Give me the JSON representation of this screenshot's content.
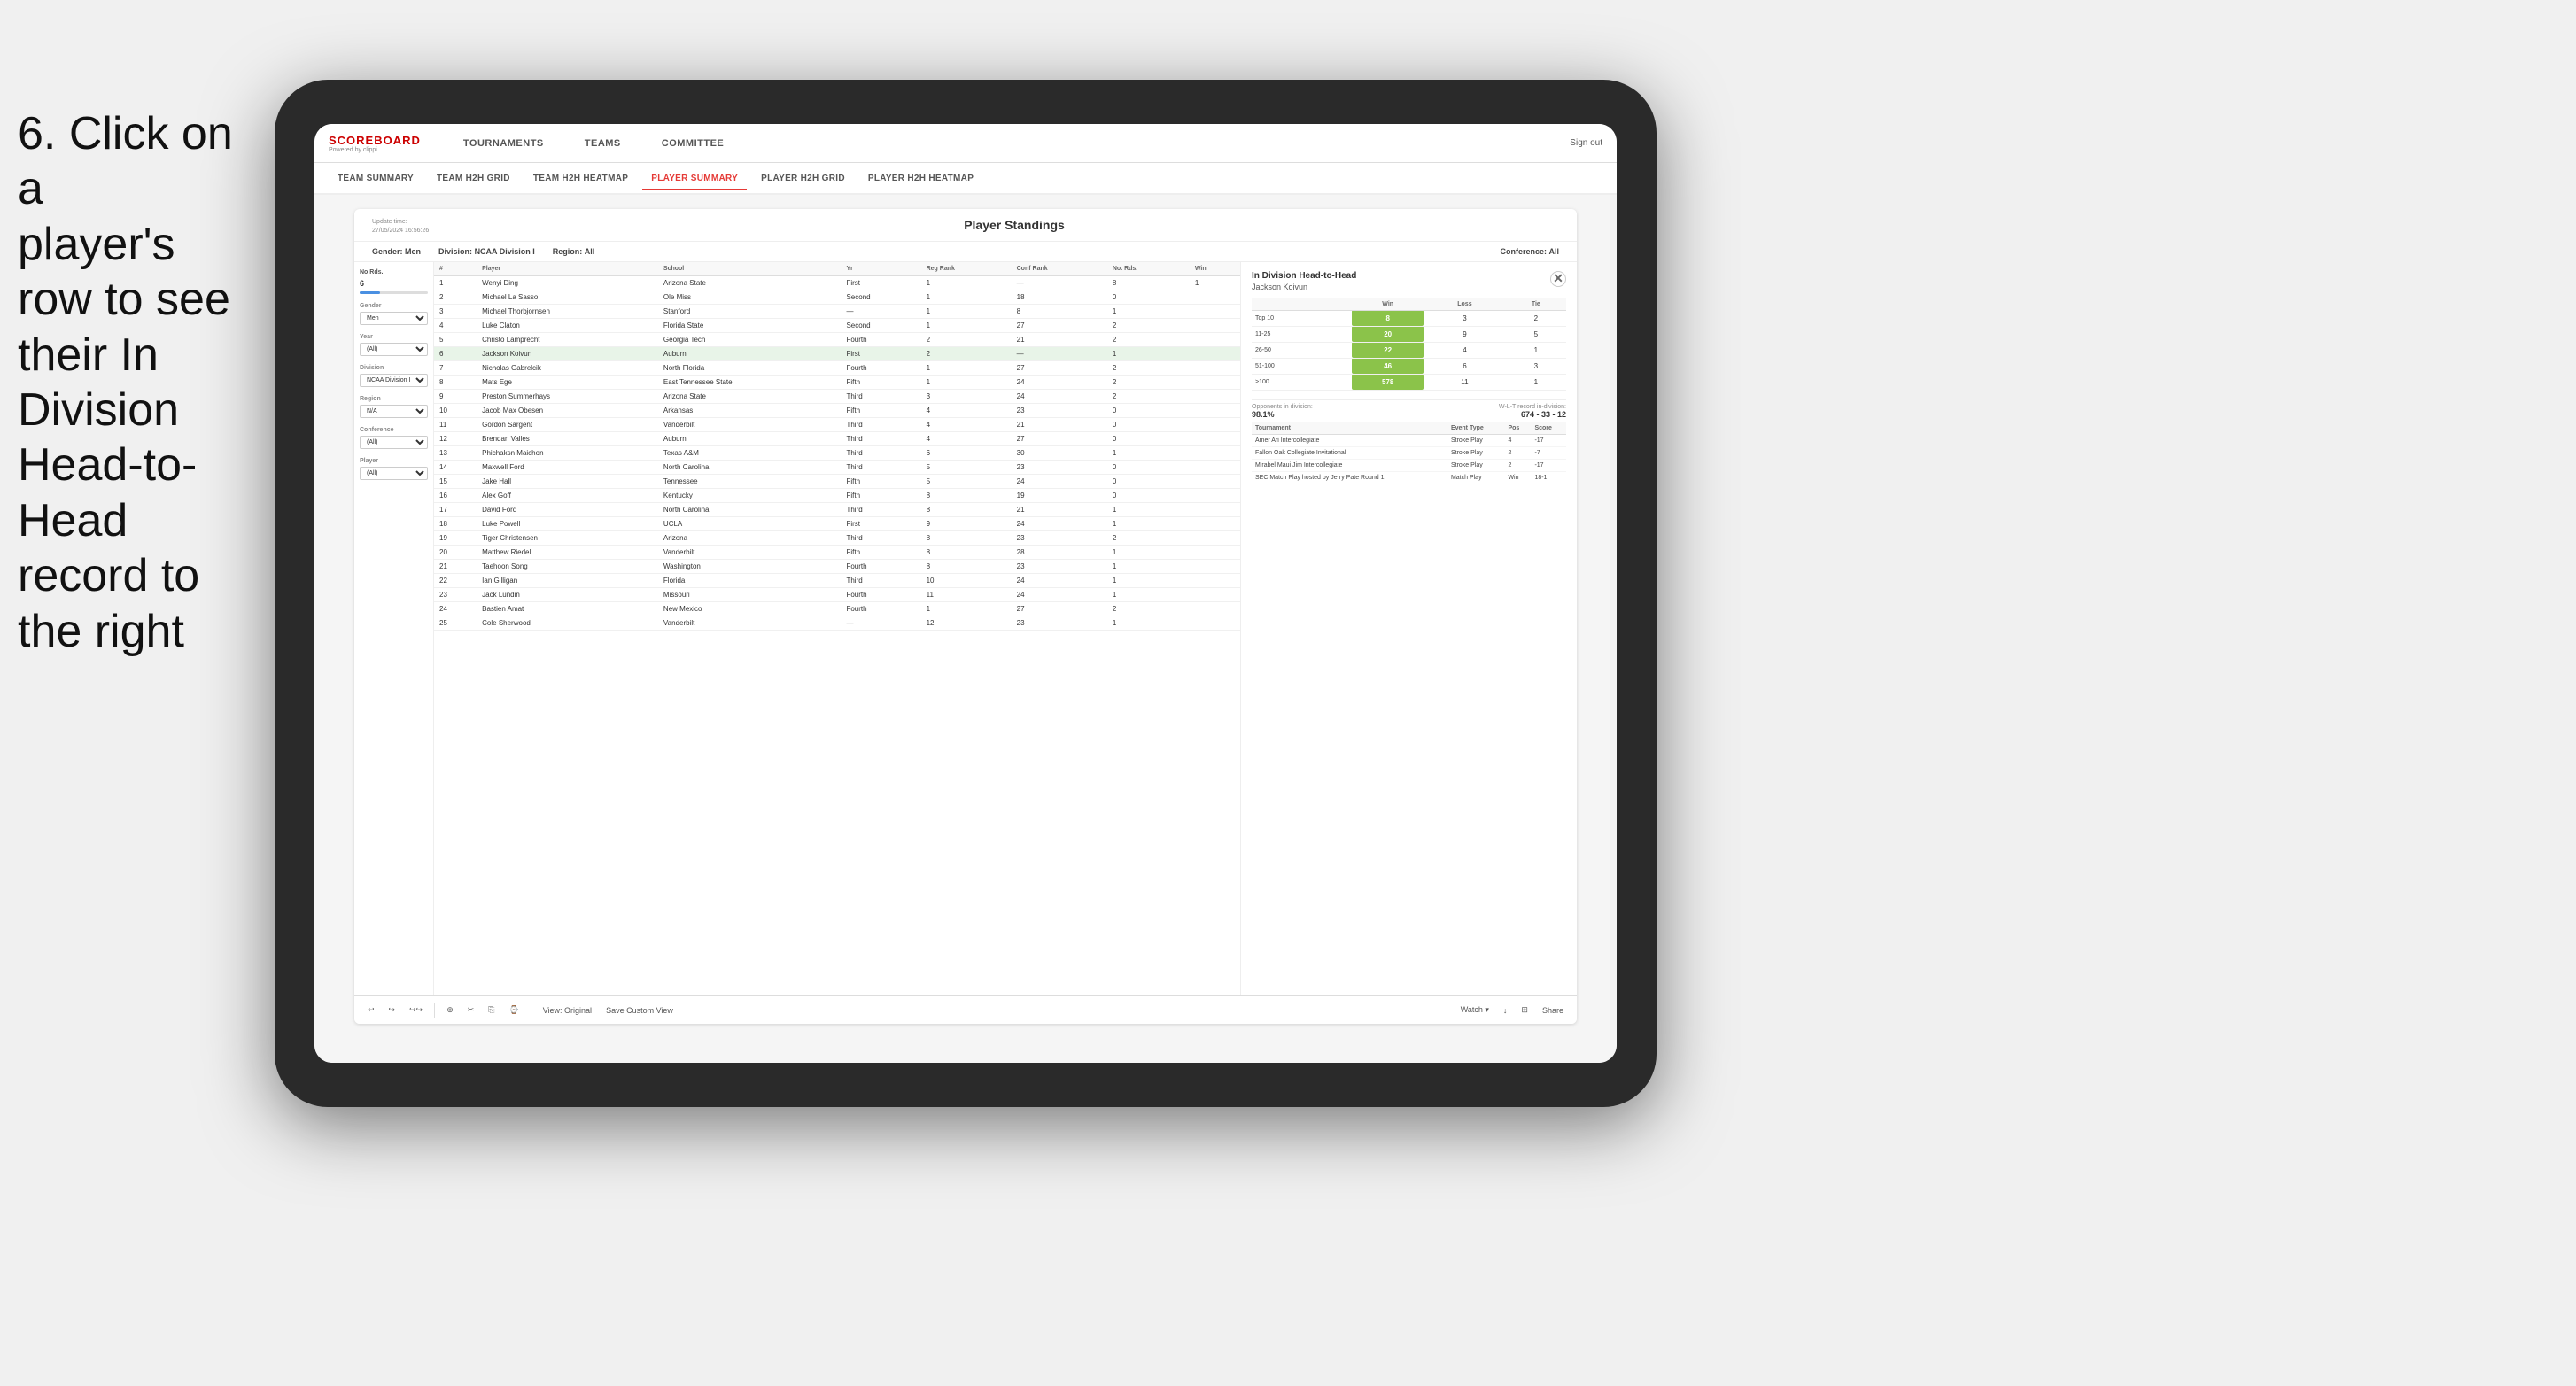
{
  "instruction": {
    "line1": "6. Click on a",
    "line2": "player's row to see",
    "line3": "their In Division",
    "line4": "Head-to-Head",
    "line5": "record to the right"
  },
  "nav": {
    "logo": "SCOREBOARD",
    "powered": "Powered by clippi",
    "items": [
      "TOURNAMENTS",
      "TEAMS",
      "COMMITTEE"
    ],
    "sign_out": "Sign out"
  },
  "sub_nav": {
    "items": [
      "TEAM SUMMARY",
      "TEAM H2H GRID",
      "TEAM H2H HEATMAP",
      "PLAYER SUMMARY",
      "PLAYER H2H GRID",
      "PLAYER H2H HEATMAP"
    ],
    "active": "PLAYER SUMMARY"
  },
  "card": {
    "update_time_label": "Update time:",
    "update_time_value": "27/05/2024 16:56:26",
    "title": "Player Standings",
    "filters": {
      "gender_label": "Gender:",
      "gender_value": "Men",
      "division_label": "Division:",
      "division_value": "NCAA Division I",
      "region_label": "Region:",
      "region_value": "All",
      "conference_label": "Conference:",
      "conference_value": "All"
    }
  },
  "sidebar": {
    "no_rds_label": "No Rds.",
    "no_rds_value": "6",
    "gender_label": "Gender",
    "gender_value": "Men",
    "year_label": "Year",
    "year_value": "(All)",
    "division_label": "Division",
    "division_value": "NCAA Division I",
    "region_label": "Region",
    "region_value": "N/A",
    "conference_label": "Conference",
    "conference_value": "(All)",
    "player_label": "Player",
    "player_value": "(All)"
  },
  "table": {
    "headers": [
      "#",
      "Player",
      "School",
      "Yr",
      "Reg Rank",
      "Conf Rank",
      "No. Rds.",
      "Win"
    ],
    "rows": [
      {
        "num": "1",
        "player": "Wenyi Ding",
        "school": "Arizona State",
        "yr": "First",
        "reg_rank": "1",
        "conf_rank": "—",
        "no_rds": "8",
        "win": "1"
      },
      {
        "num": "2",
        "player": "Michael La Sasso",
        "school": "Ole Miss",
        "yr": "Second",
        "reg_rank": "1",
        "conf_rank": "18",
        "no_rds": "0",
        "win": ""
      },
      {
        "num": "3",
        "player": "Michael Thorbjornsen",
        "school": "Stanford",
        "yr": "—",
        "reg_rank": "1",
        "conf_rank": "8",
        "no_rds": "1",
        "win": ""
      },
      {
        "num": "4",
        "player": "Luke Claton",
        "school": "Florida State",
        "yr": "Second",
        "reg_rank": "1",
        "conf_rank": "27",
        "no_rds": "2",
        "win": ""
      },
      {
        "num": "5",
        "player": "Christo Lamprecht",
        "school": "Georgia Tech",
        "yr": "Fourth",
        "reg_rank": "2",
        "conf_rank": "21",
        "no_rds": "2",
        "win": ""
      },
      {
        "num": "6",
        "player": "Jackson Koivun",
        "school": "Auburn",
        "yr": "First",
        "reg_rank": "2",
        "conf_rank": "—",
        "no_rds": "1",
        "win": "",
        "highlighted": true
      },
      {
        "num": "7",
        "player": "Nicholas Gabrelcik",
        "school": "North Florida",
        "yr": "Fourth",
        "reg_rank": "1",
        "conf_rank": "27",
        "no_rds": "2",
        "win": ""
      },
      {
        "num": "8",
        "player": "Mats Ege",
        "school": "East Tennessee State",
        "yr": "Fifth",
        "reg_rank": "1",
        "conf_rank": "24",
        "no_rds": "2",
        "win": ""
      },
      {
        "num": "9",
        "player": "Preston Summerhays",
        "school": "Arizona State",
        "yr": "Third",
        "reg_rank": "3",
        "conf_rank": "24",
        "no_rds": "2",
        "win": ""
      },
      {
        "num": "10",
        "player": "Jacob Max Obesen",
        "school": "Arkansas",
        "yr": "Fifth",
        "reg_rank": "4",
        "conf_rank": "23",
        "no_rds": "0",
        "win": ""
      },
      {
        "num": "11",
        "player": "Gordon Sargent",
        "school": "Vanderbilt",
        "yr": "Third",
        "reg_rank": "4",
        "conf_rank": "21",
        "no_rds": "0",
        "win": ""
      },
      {
        "num": "12",
        "player": "Brendan Valles",
        "school": "Auburn",
        "yr": "Third",
        "reg_rank": "4",
        "conf_rank": "27",
        "no_rds": "0",
        "win": ""
      },
      {
        "num": "13",
        "player": "Phichaksn Maichon",
        "school": "Texas A&M",
        "yr": "Third",
        "reg_rank": "6",
        "conf_rank": "30",
        "no_rds": "1",
        "win": ""
      },
      {
        "num": "14",
        "player": "Maxwell Ford",
        "school": "North Carolina",
        "yr": "Third",
        "reg_rank": "5",
        "conf_rank": "23",
        "no_rds": "0",
        "win": ""
      },
      {
        "num": "15",
        "player": "Jake Hall",
        "school": "Tennessee",
        "yr": "Fifth",
        "reg_rank": "5",
        "conf_rank": "24",
        "no_rds": "0",
        "win": ""
      },
      {
        "num": "16",
        "player": "Alex Goff",
        "school": "Kentucky",
        "yr": "Fifth",
        "reg_rank": "8",
        "conf_rank": "19",
        "no_rds": "0",
        "win": ""
      },
      {
        "num": "17",
        "player": "David Ford",
        "school": "North Carolina",
        "yr": "Third",
        "reg_rank": "8",
        "conf_rank": "21",
        "no_rds": "1",
        "win": ""
      },
      {
        "num": "18",
        "player": "Luke Powell",
        "school": "UCLA",
        "yr": "First",
        "reg_rank": "9",
        "conf_rank": "24",
        "no_rds": "1",
        "win": ""
      },
      {
        "num": "19",
        "player": "Tiger Christensen",
        "school": "Arizona",
        "yr": "Third",
        "reg_rank": "8",
        "conf_rank": "23",
        "no_rds": "2",
        "win": ""
      },
      {
        "num": "20",
        "player": "Matthew Riedel",
        "school": "Vanderbilt",
        "yr": "Fifth",
        "reg_rank": "8",
        "conf_rank": "28",
        "no_rds": "1",
        "win": ""
      },
      {
        "num": "21",
        "player": "Taehoon Song",
        "school": "Washington",
        "yr": "Fourth",
        "reg_rank": "8",
        "conf_rank": "23",
        "no_rds": "1",
        "win": ""
      },
      {
        "num": "22",
        "player": "Ian Gilligan",
        "school": "Florida",
        "yr": "Third",
        "reg_rank": "10",
        "conf_rank": "24",
        "no_rds": "1",
        "win": ""
      },
      {
        "num": "23",
        "player": "Jack Lundin",
        "school": "Missouri",
        "yr": "Fourth",
        "reg_rank": "11",
        "conf_rank": "24",
        "no_rds": "1",
        "win": ""
      },
      {
        "num": "24",
        "player": "Bastien Amat",
        "school": "New Mexico",
        "yr": "Fourth",
        "reg_rank": "1",
        "conf_rank": "27",
        "no_rds": "2",
        "win": ""
      },
      {
        "num": "25",
        "player": "Cole Sherwood",
        "school": "Vanderbilt",
        "yr": "—",
        "reg_rank": "12",
        "conf_rank": "23",
        "no_rds": "1",
        "win": ""
      }
    ]
  },
  "h2h_panel": {
    "title": "In Division Head-to-Head",
    "player_name": "Jackson Koivun",
    "close_label": "✕",
    "table_headers": [
      "",
      "Win",
      "Loss",
      "Tie"
    ],
    "rank_rows": [
      {
        "label": "Top 10",
        "win": "8",
        "loss": "3",
        "tie": "2"
      },
      {
        "label": "11-25",
        "win": "20",
        "loss": "9",
        "tie": "5"
      },
      {
        "label": "26-50",
        "win": "22",
        "loss": "4",
        "tie": "1"
      },
      {
        "label": "51-100",
        "win": "46",
        "loss": "6",
        "tie": "3"
      },
      {
        "label": ">100",
        "win": "578",
        "loss": "11",
        "tie": "1"
      }
    ],
    "opponents_label": "Opponents in division:",
    "wl_label": "W-L-T record in-division:",
    "opponents_pct": "98.1%",
    "wl_record": "674 - 33 - 12",
    "tournament_headers": [
      "Tournament",
      "Event Type",
      "Pos",
      "Score"
    ],
    "tournament_rows": [
      {
        "tournament": "Amer Ari Intercollegiate",
        "event_type": "Stroke Play",
        "pos": "4",
        "score": "-17"
      },
      {
        "tournament": "Fallon Oak Collegiate Invitational",
        "event_type": "Stroke Play",
        "pos": "2",
        "score": "-7"
      },
      {
        "tournament": "Mirabel Maui Jim Intercollegiate",
        "event_type": "Stroke Play",
        "pos": "2",
        "score": "-17"
      },
      {
        "tournament": "SEC Match Play hosted by Jerry Pate Round 1",
        "event_type": "Match Play",
        "pos": "Win",
        "score": "18-1"
      }
    ]
  },
  "toolbar": {
    "buttons": [
      "↩",
      "↪",
      "↪↪",
      "⊕",
      "✂",
      "⎘",
      "⌚",
      "View: Original",
      "Save Custom View",
      "Watch ▾",
      "↓",
      "⊞",
      "Share"
    ]
  }
}
